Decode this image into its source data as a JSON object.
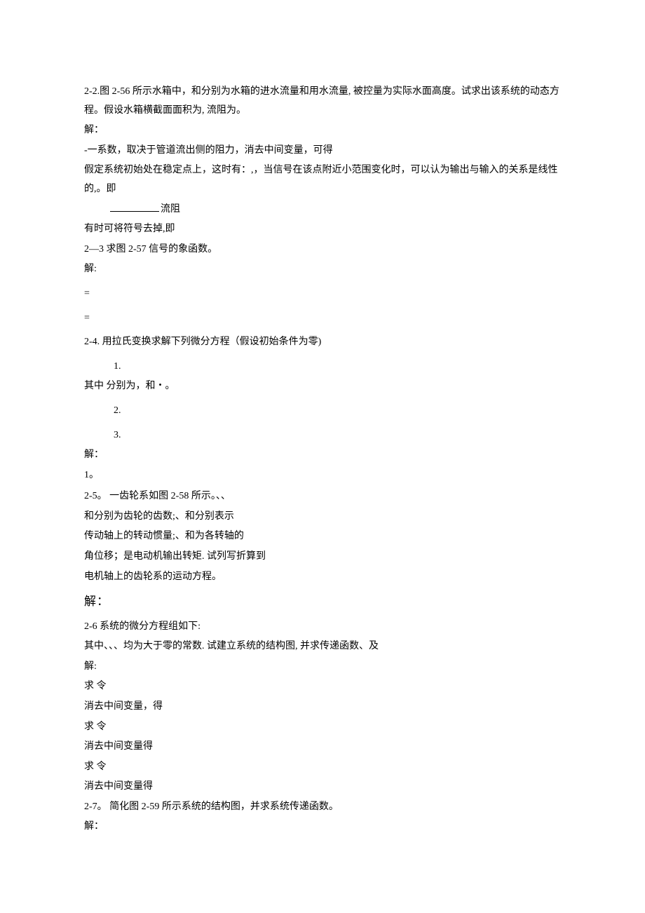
{
  "p22": {
    "l1": "2-2.图 2-56 所示水箱中，和分别为水箱的进水流量和用水流量, 被控量为实际水面高度。试求出该系统的动态方程。假设水箱横截面面积为, 流阻为。",
    "l2": "解：",
    "l3": "-一系数，取决于管道流出侧的阻力，消去中间变量，可得",
    "l4": "假定系统初始处在稳定点上，这时有：,，当信号在该点附近小范围变化时，可以认为输出与输入的关系是线性的,。即",
    "l5pre": "",
    "l5post": "流阻",
    "l6": "有时可将符号去掉,即"
  },
  "p23": {
    "l1": "2—3  求图 2-57 信号的象函数。",
    "l2": "解:",
    "eq1": "=",
    "eq2": "="
  },
  "p24": {
    "l1": "2-4.  用拉氏变换求解下列微分方程（假设初始条件为零)",
    "item1": "1.",
    "l2": "其中      分别为，和・。",
    "item2": "2.",
    "item3": "3.",
    "l3": "解：",
    "l4": "1。"
  },
  "p25": {
    "l1": "2-5。  一齿轮系如图 2-58 所示。、、",
    "l2": "和分别为齿轮的齿数;、和分别表示",
    "l3": "传动轴上的转动惯量;、和为各转轴的",
    "l4": "角位移；是电动机输出转矩. 试列写折算到",
    "l5": "电机轴上的齿轮系的运动方程。",
    "l6": "解："
  },
  "p26": {
    "l1": "2-6  系统的微分方程组如下:",
    "l2": "其中、、、均为大于零的常数. 试建立系统的结构图, 并求传递函数、及",
    "l3": "解:",
    "l4": "求  令",
    "l5": "消去中间变量，得",
    "l6": "求  令",
    "l7": "消去中间变量得",
    "l8": "求  令",
    "l9": "消去中间变量得"
  },
  "p27": {
    "l1": "2-7。  简化图 2-59 所示系统的结构图，并求系统传递函数。",
    "l2": "解："
  }
}
